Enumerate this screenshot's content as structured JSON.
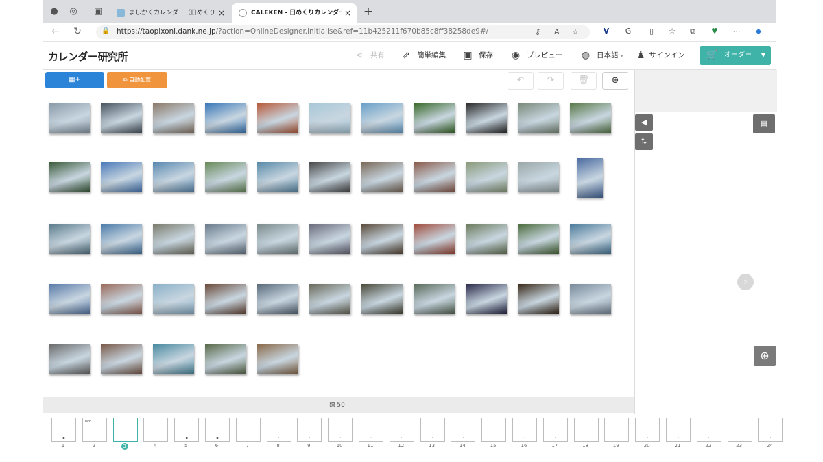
{
  "browser": {
    "tabs": [
      {
        "title": "ましかくカレンダー（日めくり）・",
        "active": false
      },
      {
        "title": "CALEKEN - 日めくりカレンダー(",
        "active": true
      }
    ],
    "new_tab_label": "+",
    "close_label": "×",
    "url_host": "https://taopixonl.dank.ne.jp",
    "url_path": "/?action=OnlineDesigner.initialise&ref=11b425211f670b85c8ff38258de9#/"
  },
  "app": {
    "logo": "カレンダー研究所",
    "header": {
      "share_label": "共有",
      "simple_edit_label": "簡単編集",
      "save_label": "保存",
      "preview_label": "プレビュー",
      "language_label": "日本語",
      "signin_label": "サインイン",
      "order_label": "オーダー"
    },
    "toolbar": {
      "add_photo_label": "+",
      "auto_place_label": "自動配置"
    },
    "gallery": {
      "photo_count": "50",
      "thumbs": [
        {
          "c": "#8a9aa8"
        },
        {
          "c": "#4a5560"
        },
        {
          "c": "#8c7a6a"
        },
        {
          "c": "#3a78b8"
        },
        {
          "c": "#b85a3a"
        },
        {
          "c": "#a8c8d8"
        },
        {
          "c": "#6aa0c8"
        },
        {
          "c": "#3a6a2a"
        },
        {
          "c": "#2a2a2a"
        },
        {
          "c": "#7a8a7a"
        },
        {
          "c": "#5a7a4a"
        },
        {
          "c": "#3a5a3a"
        },
        {
          "c": "#4a7ab8"
        },
        {
          "c": "#5a88b0"
        },
        {
          "c": "#6a8a5a"
        },
        {
          "c": "#5a8aa8"
        },
        {
          "c": "#4a4a4a"
        },
        {
          "c": "#7a6a5a"
        },
        {
          "c": "#8a5a4a"
        },
        {
          "c": "#8a9a7a"
        },
        {
          "c": "#9aa8a8"
        },
        {
          "c": "#4a6aa0"
        },
        {
          "c": "#5a7a8a"
        },
        {
          "c": "#4a7aa8"
        },
        {
          "c": "#7a7a6a"
        },
        {
          "c": "#6a7a8a"
        },
        {
          "c": "#7a8a8a"
        },
        {
          "c": "#6a6a7a"
        },
        {
          "c": "#5a4a3a"
        },
        {
          "c": "#a04a3a"
        },
        {
          "c": "#6a7a5a"
        },
        {
          "c": "#4a6a3a"
        },
        {
          "c": "#4a7a9a"
        },
        {
          "c": "#5a7aa8"
        },
        {
          "c": "#9a6a5a"
        },
        {
          "c": "#8ab0c8"
        },
        {
          "c": "#6a4a3a"
        },
        {
          "c": "#5a6a7a"
        },
        {
          "c": "#6a6a5a"
        },
        {
          "c": "#4a4a3a"
        },
        {
          "c": "#5a6a5a"
        },
        {
          "c": "#2a2a4a"
        },
        {
          "c": "#3a2a1a"
        },
        {
          "c": "#7a8a9a"
        },
        {
          "c": "#6a6a6a"
        },
        {
          "c": "#7a5a4a"
        },
        {
          "c": "#4a8aa0"
        },
        {
          "c": "#5a6a4a"
        },
        {
          "c": "#8a6a4a"
        }
      ]
    },
    "pages": [
      {
        "n": "1",
        "mark": "▪"
      },
      {
        "n": "2",
        "mark": "",
        "text": "Tarq"
      },
      {
        "n": "3",
        "selected": true,
        "mark": ""
      },
      {
        "n": "4",
        "mark": ""
      },
      {
        "n": "5",
        "mark": "▪"
      },
      {
        "n": "6",
        "mark": "▪"
      },
      {
        "n": "7",
        "mark": "·"
      },
      {
        "n": "8",
        "mark": "·"
      },
      {
        "n": "9",
        "mark": "·"
      },
      {
        "n": "10",
        "mark": "·"
      },
      {
        "n": "11",
        "mark": "·"
      },
      {
        "n": "12",
        "mark": "·"
      },
      {
        "n": "13",
        "mark": "·"
      },
      {
        "n": "14",
        "mark": "·"
      },
      {
        "n": "15",
        "mark": ""
      },
      {
        "n": "16",
        "mark": "·"
      },
      {
        "n": "17",
        "mark": "·"
      },
      {
        "n": "18",
        "mark": "·"
      },
      {
        "n": "19",
        "mark": "·"
      },
      {
        "n": "20",
        "mark": "·"
      },
      {
        "n": "21",
        "mark": "·"
      },
      {
        "n": "22",
        "mark": "·"
      },
      {
        "n": "23",
        "mark": ""
      },
      {
        "n": "24",
        "mark": "·"
      }
    ]
  },
  "icons": {
    "add_photo": "photo-add-icon",
    "auto_place": "auto-arrange-icon",
    "undo": "undo-icon",
    "redo": "redo-icon",
    "trash": "trash-icon",
    "zoom": "zoom-in-icon"
  },
  "colors": {
    "order": "#3fb3a8",
    "add": "#2c84d8",
    "auto": "#f0953d"
  }
}
